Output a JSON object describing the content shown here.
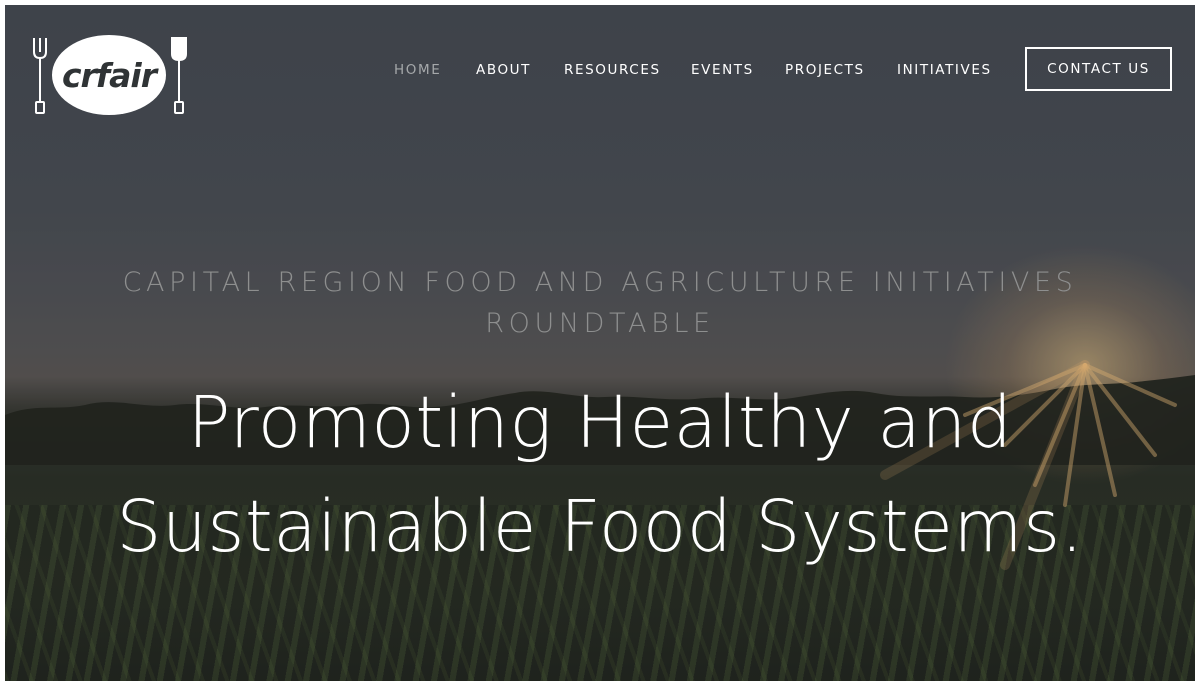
{
  "brand": {
    "logo_text": "crfair",
    "fork_icon": "fork-icon",
    "shovel_icon": "shovel-icon"
  },
  "nav": {
    "items": [
      {
        "label": "HOME",
        "active": true
      },
      {
        "label": "ABOUT",
        "active": false
      },
      {
        "label": "RESOURCES",
        "active": false
      },
      {
        "label": "EVENTS",
        "active": false
      },
      {
        "label": "PROJECTS",
        "active": false
      },
      {
        "label": "INITIATIVES",
        "active": false
      }
    ],
    "contact_label": "CONTACT US"
  },
  "hero": {
    "kicker_line1": "CAPITAL REGION FOOD AND AGRICULTURE INITIATIVES",
    "kicker_line2": "ROUNDTABLE",
    "headline_line1": "Promoting Healthy and",
    "headline_line2": "Sustainable Food Systems."
  },
  "colors": {
    "nav_text": "#ffffff",
    "nav_active": "#a5a8aa",
    "kicker": "#8e8f8f",
    "headline": "#ffffff"
  }
}
